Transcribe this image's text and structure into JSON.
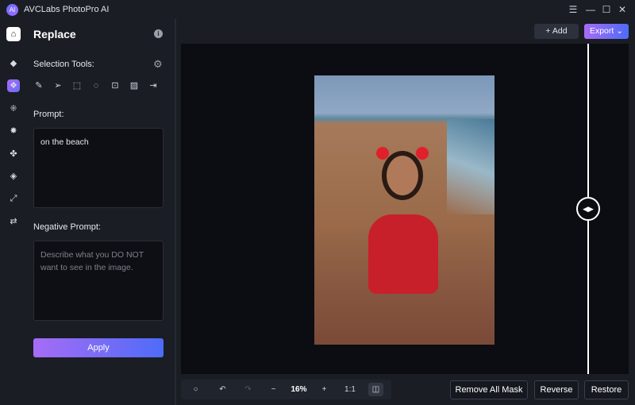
{
  "app": {
    "title": "AVCLabs PhotoPro AI",
    "logo_text": "AI"
  },
  "window_controls": {
    "menu": "☰",
    "minimize": "—",
    "maximize": "☐",
    "close": "✕"
  },
  "rail": [
    {
      "name": "home-icon",
      "glyph": "⌂"
    },
    {
      "name": "eraser-icon",
      "glyph": "◆"
    },
    {
      "name": "replace-icon",
      "glyph": "❖"
    },
    {
      "name": "enhance-icon",
      "glyph": "⁜"
    },
    {
      "name": "background-icon",
      "glyph": "✸"
    },
    {
      "name": "fan-icon",
      "glyph": "✤"
    },
    {
      "name": "colorize-icon",
      "glyph": "◈"
    },
    {
      "name": "upscale-icon",
      "glyph": "⤢"
    },
    {
      "name": "adjust-icon",
      "glyph": "⇄"
    }
  ],
  "panel": {
    "title": "Replace",
    "selection_tools_label": "Selection Tools:",
    "tools": [
      {
        "name": "brush-icon",
        "glyph": "✎"
      },
      {
        "name": "pointer-icon",
        "glyph": "➢"
      },
      {
        "name": "rectangle-select-icon",
        "glyph": "⬚"
      },
      {
        "name": "ellipse-select-icon",
        "glyph": "◌"
      },
      {
        "name": "portrait-select-icon",
        "glyph": "⊡"
      },
      {
        "name": "pattern-select-icon",
        "glyph": "▨"
      },
      {
        "name": "import-mask-icon",
        "glyph": "⇥"
      }
    ],
    "prompt_label": "Prompt:",
    "prompt_value": "on the beach",
    "negative_label": "Negative Prompt:",
    "negative_placeholder": "Describe what you DO NOT want to see in the image.",
    "apply_label": "Apply"
  },
  "toolbar": {
    "add_label": "+ Add",
    "export_label": "Export ⌄"
  },
  "bottom": {
    "zoom": "16%",
    "one_to_one": "1:1",
    "remove_all_mask": "Remove All Mask",
    "reverse": "Reverse",
    "restore": "Restore"
  },
  "colors": {
    "accent_start": "#a66cf6",
    "accent_end": "#4e6cf7"
  }
}
